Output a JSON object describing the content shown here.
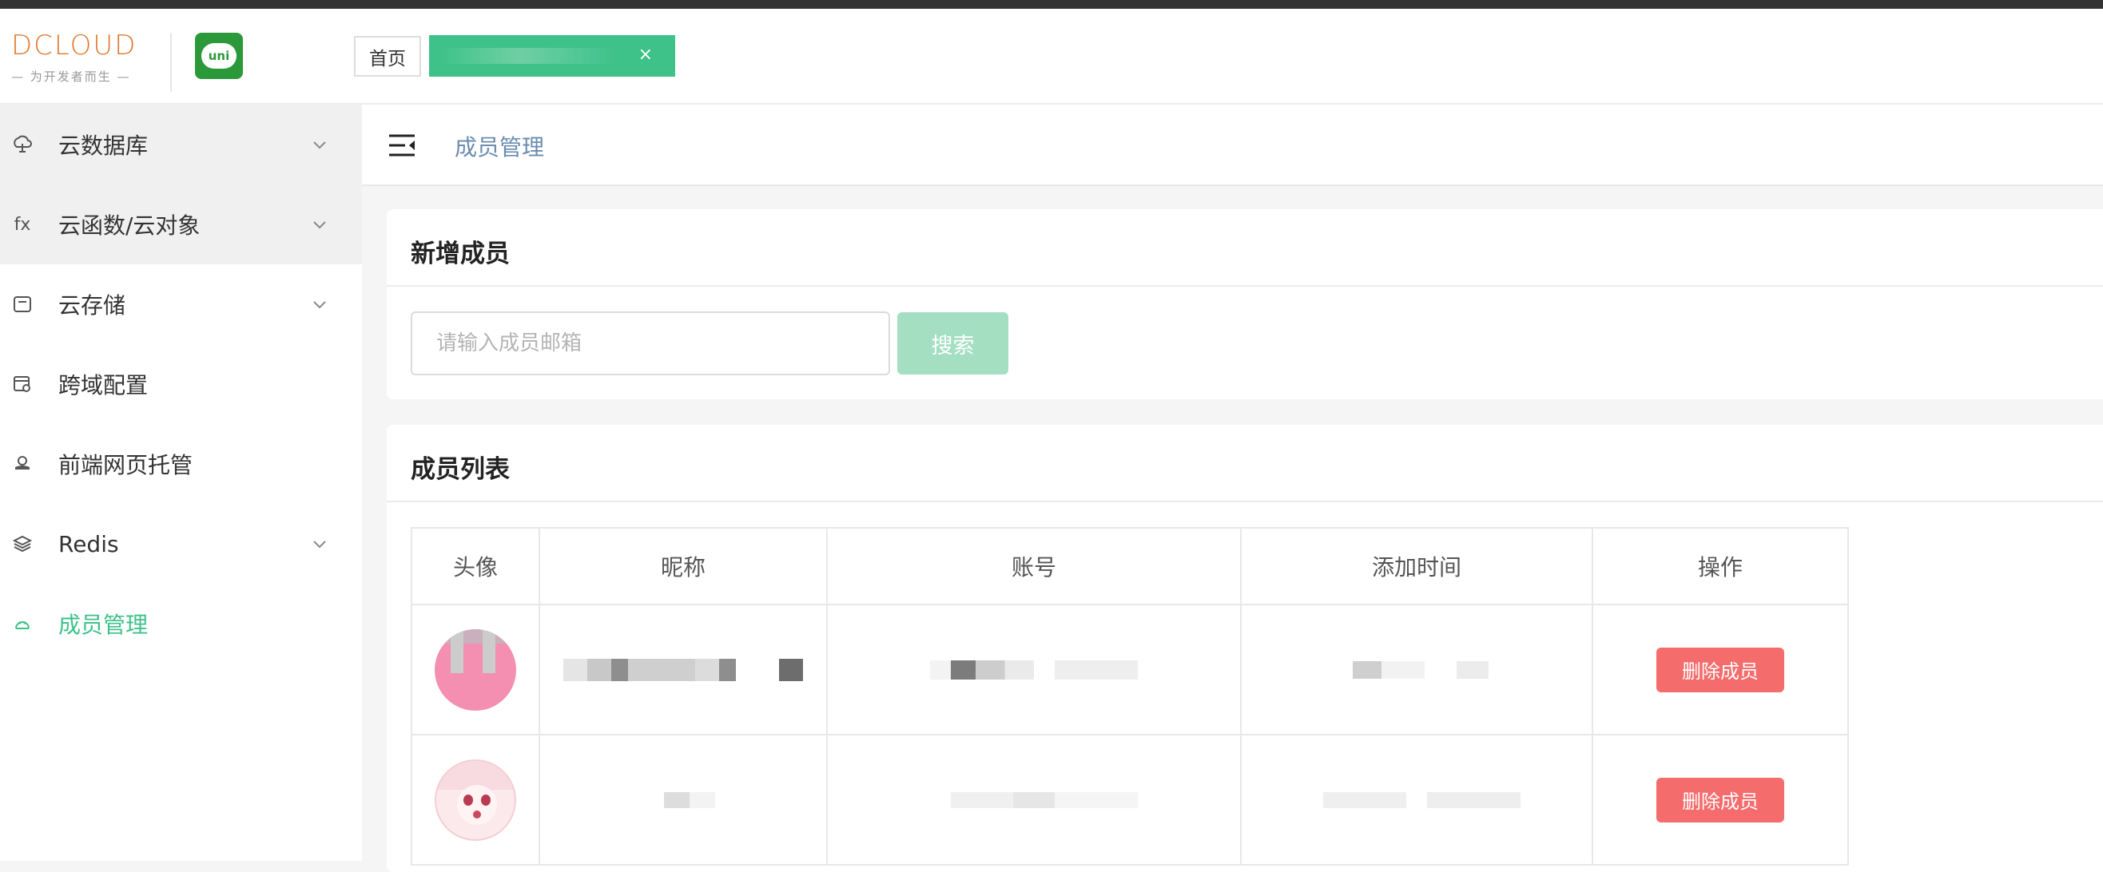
{
  "header": {
    "logo_text": "DCLOUD",
    "logo_slogan": "— 为开发者而生 —",
    "uni_logo_text": "uni",
    "tabs": [
      {
        "label": "首页"
      },
      {
        "label": "",
        "close": "×"
      }
    ]
  },
  "sidebar": {
    "items": [
      {
        "label": "云数据库",
        "icon": "cloud-db-icon",
        "expandable": true
      },
      {
        "label": "云函数/云对象",
        "icon": "fx-icon",
        "icon_text": "fx",
        "expandable": true
      },
      {
        "label": "云存储",
        "icon": "storage-icon",
        "expandable": true
      },
      {
        "label": "跨域配置",
        "icon": "cross-domain-icon",
        "expandable": false
      },
      {
        "label": "前端网页托管",
        "icon": "hosting-icon",
        "expandable": false
      },
      {
        "label": "Redis",
        "icon": "redis-icon",
        "expandable": true
      },
      {
        "label": "成员管理",
        "icon": "member-icon",
        "expandable": false,
        "active": true
      }
    ]
  },
  "breadcrumb": {
    "current": "成员管理"
  },
  "add_member": {
    "title": "新增成员",
    "search_placeholder": "请输入成员邮箱",
    "search_label": "搜索"
  },
  "member_list": {
    "title": "成员列表",
    "columns": [
      "头像",
      "昵称",
      "账号",
      "添加时间",
      "操作"
    ],
    "rows": [
      {
        "delete_label": "删除成员"
      },
      {
        "delete_label": "删除成员"
      }
    ]
  },
  "colors": {
    "accent": "#3ec28a",
    "accent_light": "#a4dfc2",
    "danger": "#f56c6c",
    "breadcrumb": "#6b8cb0"
  }
}
